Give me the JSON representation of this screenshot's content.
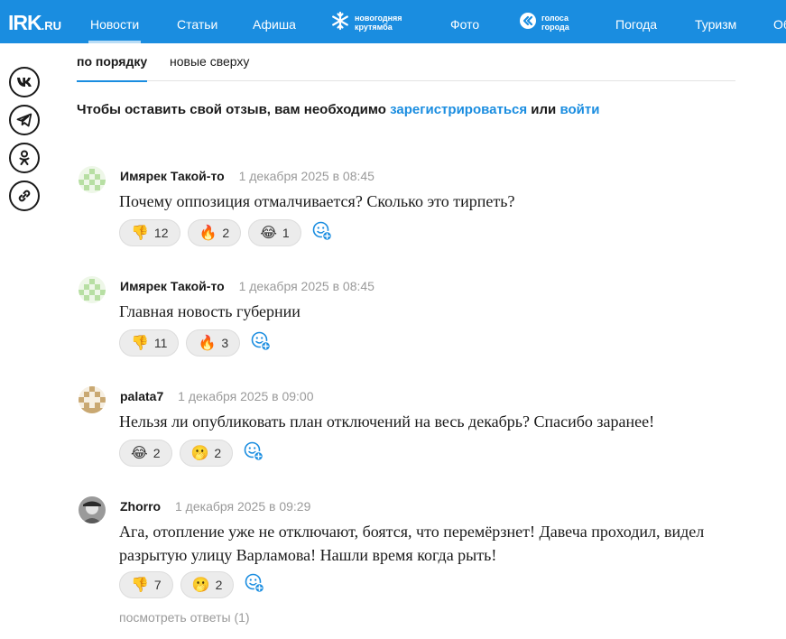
{
  "header": {
    "logo_main": "IRK",
    "logo_suffix": ".RU",
    "nav": [
      {
        "label": "Новости",
        "active": true
      },
      {
        "label": "Статьи"
      },
      {
        "label": "Афиша"
      },
      {
        "label": "Фото"
      },
      {
        "label": "Погода"
      },
      {
        "label": "Туризм"
      },
      {
        "label": "Об"
      }
    ],
    "promo_newyear": {
      "line1": "новогодняя",
      "line2": "крутямба"
    },
    "promo_voices": {
      "line1": "голоса",
      "line2": "города"
    }
  },
  "share": [
    {
      "icon": "vk-icon"
    },
    {
      "icon": "telegram-icon"
    },
    {
      "icon": "odnoklassniki-icon"
    },
    {
      "icon": "link-icon"
    }
  ],
  "sort": {
    "by_order": "по порядку",
    "newest_first": "новые сверху"
  },
  "login_note": {
    "prefix": "Чтобы оставить свой отзыв, вам необходимо ",
    "register": "зарегистрироваться",
    "middle": " или ",
    "login": "войти"
  },
  "comments": [
    {
      "author": "Имярек Такой-то",
      "date": "1 декабря 2025 в 08:45",
      "text": "Почему оппозиция отмалчивается? Сколько это тирпеть?",
      "reactions": [
        {
          "emoji": "👎",
          "count": "12"
        },
        {
          "emoji": "🔥",
          "count": "2"
        },
        {
          "emoji": "😂",
          "count": "1"
        }
      ]
    },
    {
      "author": "Имярек Такой-то",
      "date": "1 декабря 2025 в 08:45",
      "text": "Главная новость губернии",
      "reactions": [
        {
          "emoji": "👎",
          "count": "11"
        },
        {
          "emoji": "🔥",
          "count": "3"
        }
      ]
    },
    {
      "author": "palata7",
      "date": "1 декабря 2025 в 09:00",
      "text": "Нельзя ли опубликовать план отключений на весь декабрь? Спасибо заранее!",
      "reactions": [
        {
          "emoji": "😂",
          "count": "2"
        },
        {
          "emoji": "🫢",
          "count": "2"
        }
      ]
    },
    {
      "author": "Zhorro",
      "date": "1 декабря 2025 в 09:29",
      "text": "Ага, отопление уже не отключают, боятся, что перемёрзнет! Давеча проходил, видел разрытую улицу Варламова! Нашли время когда рыть!",
      "reactions": [
        {
          "emoji": "👎",
          "count": "7"
        },
        {
          "emoji": "🫢",
          "count": "2"
        }
      ],
      "view_replies": "посмотреть ответы (1)"
    }
  ],
  "colors": {
    "brand": "#1a8de0",
    "link": "#1a8de0",
    "muted": "#9a9a9a",
    "chip": "#ececec"
  }
}
